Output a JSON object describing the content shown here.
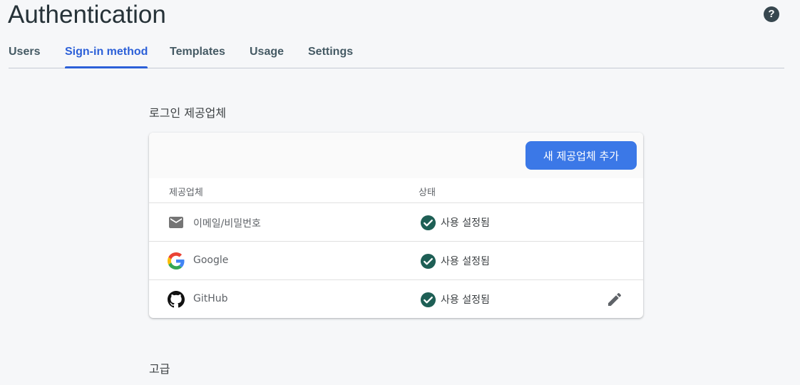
{
  "page": {
    "title": "Authentication"
  },
  "tabs": [
    {
      "label": "Users",
      "active": false
    },
    {
      "label": "Sign-in method",
      "active": true
    },
    {
      "label": "Templates",
      "active": false
    },
    {
      "label": "Usage",
      "active": false
    },
    {
      "label": "Settings",
      "active": false
    }
  ],
  "providers_section": {
    "heading": "로그인 제공업체",
    "add_button": "새 제공업체 추가",
    "columns": {
      "provider": "제공업체",
      "status": "상태"
    },
    "rows": [
      {
        "icon": "email-icon",
        "name": "이메일/비밀번호",
        "status": "사용 설정됨",
        "editable": false
      },
      {
        "icon": "google-icon",
        "name": "Google",
        "status": "사용 설정됨",
        "editable": false
      },
      {
        "icon": "github-icon",
        "name": "GitHub",
        "status": "사용 설정됨",
        "editable": true
      }
    ]
  },
  "advanced_section": {
    "heading": "고급"
  },
  "colors": {
    "accent": "#2c60d8",
    "button": "#3b78e7",
    "status_check": "#1e5f55"
  }
}
